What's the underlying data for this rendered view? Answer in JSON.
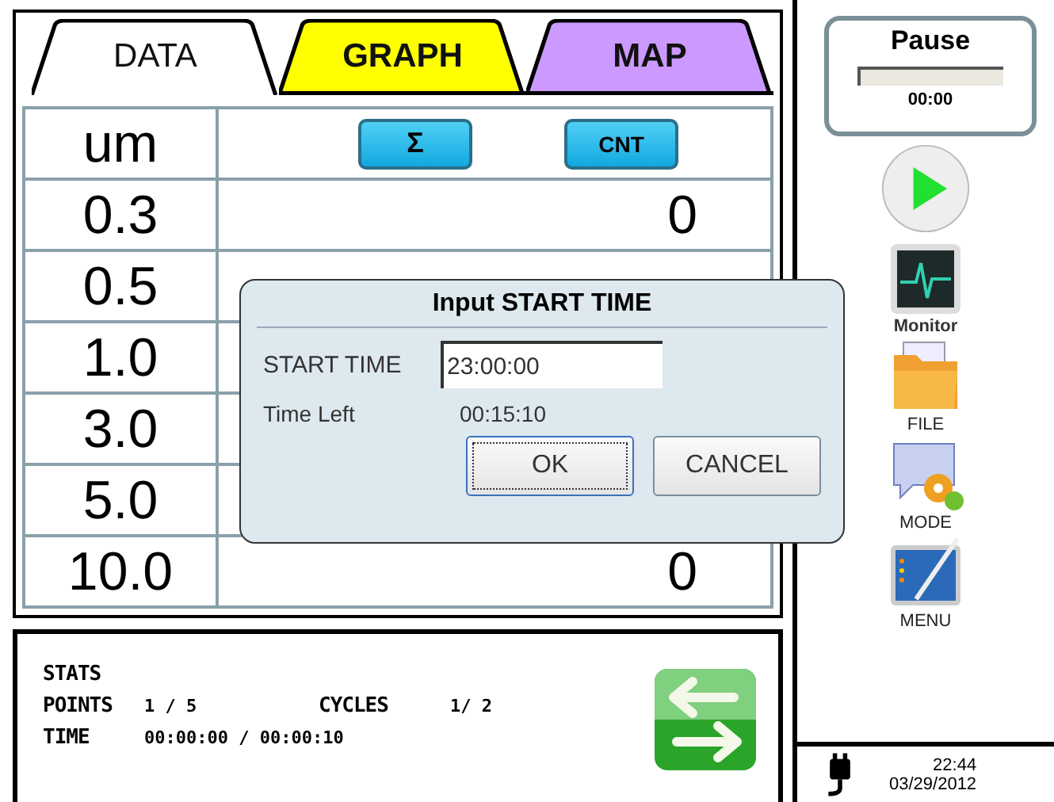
{
  "tabs": [
    {
      "label": "DATA",
      "selected": true,
      "color": "#ffffff"
    },
    {
      "label": "GRAPH",
      "selected": false,
      "color": "#ffff00"
    },
    {
      "label": "MAP",
      "selected": false,
      "color": "#cc99ff"
    }
  ],
  "table": {
    "header": "um",
    "buttons": [
      "Σ",
      "CNT"
    ],
    "rows": [
      {
        "size": "0.3",
        "count": "0"
      },
      {
        "size": "0.5"
      },
      {
        "size": "1.0"
      },
      {
        "size": "3.0"
      },
      {
        "size": "5.0"
      },
      {
        "size": "10.0",
        "count": "0"
      }
    ]
  },
  "stats": {
    "title": "STATS",
    "points_label": "POINTS",
    "points": "1 / 5",
    "cycles_label": "CYCLES",
    "cycles": "1/ 2",
    "time_label": "TIME",
    "time": "00:00:00 / 00:00:10"
  },
  "pause": {
    "title": "Pause",
    "level": 0,
    "time": "00:00"
  },
  "sidebar": {
    "items": [
      {
        "kind": "monitor",
        "label": "Monitor"
      },
      {
        "kind": "file",
        "label": "FILE"
      },
      {
        "kind": "mode",
        "label": "MODE"
      },
      {
        "kind": "menu",
        "label": "MENU"
      }
    ]
  },
  "status": {
    "time": "22:44",
    "date": "03/29/2012"
  },
  "dialog": {
    "title": "Input START TIME",
    "field_label": "START TIME",
    "field_value": "23:00:00",
    "left_label": "Time Left",
    "left_value": "00:15:10",
    "buttons": [
      "OK",
      "CANCEL"
    ]
  }
}
